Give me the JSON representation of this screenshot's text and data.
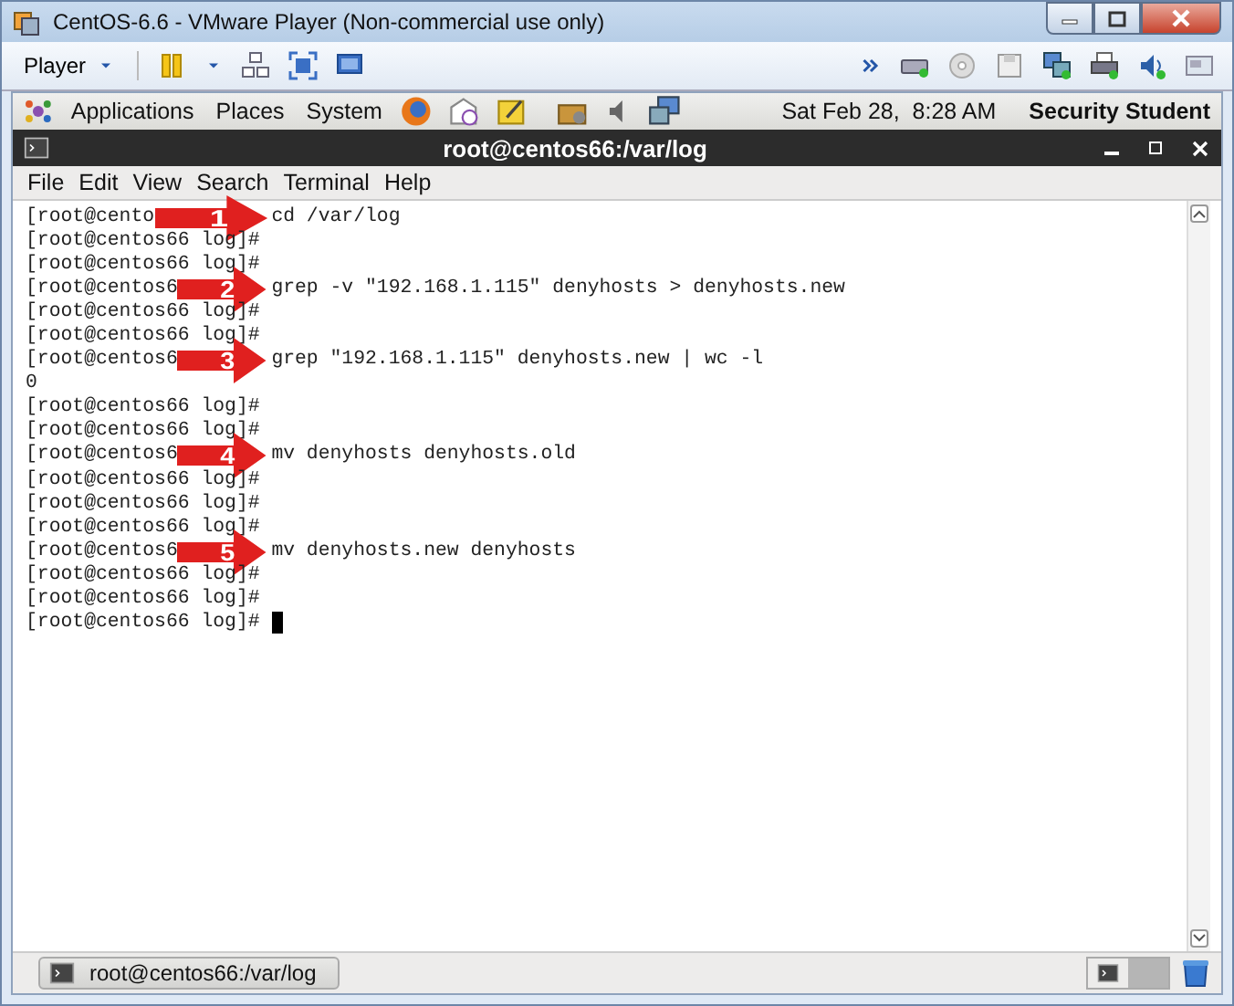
{
  "window": {
    "title": "CentOS-6.6 - VMware Player (Non-commercial use only)"
  },
  "vm_toolbar": {
    "menu": "Player"
  },
  "gnome_panel": {
    "menus": [
      "Applications",
      "Places",
      "System"
    ],
    "clock": "Sat Feb 28,  8:28 AM",
    "user": "Security Student"
  },
  "terminal": {
    "title": "root@centos66:/var/log",
    "menu": [
      "File",
      "Edit",
      "View",
      "Search",
      "Terminal",
      "Help"
    ],
    "lines": [
      {
        "kind": "callout",
        "prompt": "[root@cento",
        "command": "cd /var/log",
        "callout": "1"
      },
      {
        "kind": "output",
        "text": "[root@centos66 log]#"
      },
      {
        "kind": "output",
        "text": "[root@centos66 log]#"
      },
      {
        "kind": "callout",
        "prompt": "[root@centos6",
        "command": "grep -v \"192.168.1.115\" denyhosts > denyhosts.new",
        "callout": "2"
      },
      {
        "kind": "output",
        "text": "[root@centos66 log]#"
      },
      {
        "kind": "output",
        "text": "[root@centos66 log]#"
      },
      {
        "kind": "callout",
        "prompt": "[root@centos6",
        "command": "grep \"192.168.1.115\" denyhosts.new | wc -l",
        "callout": "3"
      },
      {
        "kind": "output",
        "text": "0"
      },
      {
        "kind": "output",
        "text": "[root@centos66 log]#"
      },
      {
        "kind": "output",
        "text": "[root@centos66 log]#"
      },
      {
        "kind": "callout",
        "prompt": "[root@centos6",
        "command": "mv denyhosts denyhosts.old",
        "callout": "4"
      },
      {
        "kind": "output",
        "text": "[root@centos66 log]#"
      },
      {
        "kind": "output",
        "text": "[root@centos66 log]#"
      },
      {
        "kind": "output",
        "text": "[root@centos66 log]#"
      },
      {
        "kind": "callout",
        "prompt": "[root@centos6",
        "command": "mv denyhosts.new denyhosts",
        "callout": "5"
      },
      {
        "kind": "output",
        "text": "[root@centos66 log]#"
      },
      {
        "kind": "output",
        "text": "[root@centos66 log]#"
      },
      {
        "kind": "input",
        "text": "[root@centos66 log]#"
      }
    ]
  },
  "taskbar": {
    "items": [
      "root@centos66:/var/log"
    ]
  }
}
